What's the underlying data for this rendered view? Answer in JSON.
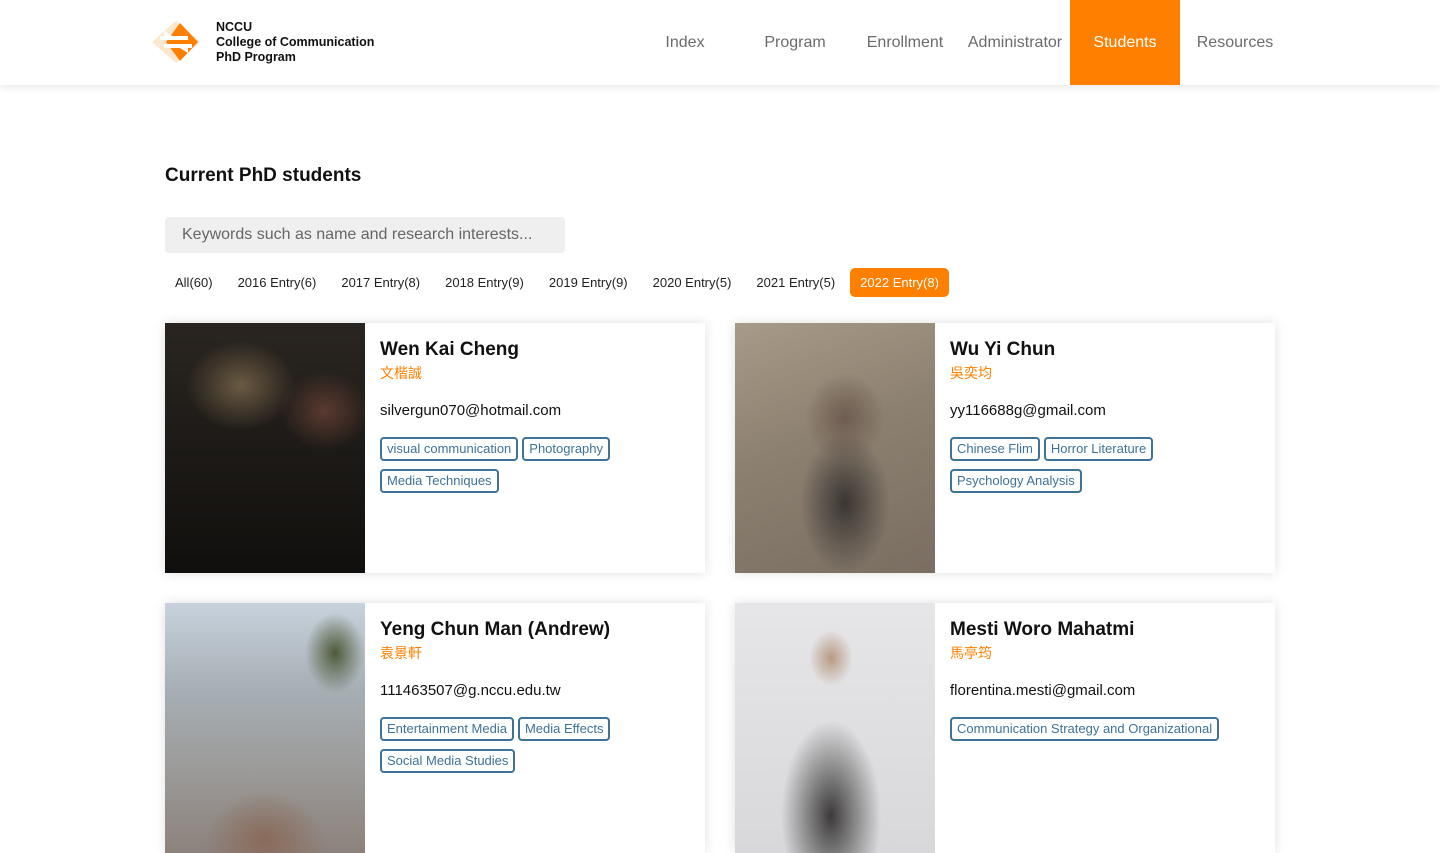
{
  "header": {
    "logo_lines": [
      "NCCU",
      "College of Communication",
      "PhD Program"
    ],
    "nav": [
      {
        "label": "Index"
      },
      {
        "label": "Program"
      },
      {
        "label": "Enrollment"
      },
      {
        "label": "Administrator"
      },
      {
        "label": "Students",
        "active": true
      },
      {
        "label": "Resources"
      }
    ],
    "accent_color": "#ff8000"
  },
  "main": {
    "title": "Current PhD students",
    "search": {
      "placeholder": "Keywords such as name and research interests...",
      "value": ""
    },
    "filters": [
      {
        "label": "All(60)"
      },
      {
        "label": "2016 Entry(6)"
      },
      {
        "label": "2017 Entry(8)"
      },
      {
        "label": "2018 Entry(9)"
      },
      {
        "label": "2019 Entry(9)"
      },
      {
        "label": "2020 Entry(5)"
      },
      {
        "label": "2021 Entry(5)"
      },
      {
        "label": "2022 Entry(8)",
        "active": true
      }
    ],
    "students": [
      {
        "name": "Wen Kai Cheng",
        "chinese_name": "文楷誠",
        "email": "silvergun070@hotmail.com",
        "tags": [
          "visual communication",
          "Photography",
          "Media Techniques"
        ]
      },
      {
        "name": "Wu Yi Chun",
        "chinese_name": "吳奕均",
        "email": "yy116688g@gmail.com",
        "tags": [
          "Chinese Flim",
          "Horror Literature",
          "Psychology Analysis"
        ]
      },
      {
        "name": "Yeng Chun Man (Andrew)",
        "chinese_name": "袁景軒",
        "email": "111463507@g.nccu.edu.tw",
        "tags": [
          "Entertainment Media",
          "Media Effects",
          "Social Media Studies"
        ]
      },
      {
        "name": "Mesti Woro Mahatmi",
        "chinese_name": "馬亭筠",
        "email": "florentina.mesti@gmail.com",
        "tags": [
          "Communication Strategy and Organizational"
        ]
      }
    ]
  }
}
